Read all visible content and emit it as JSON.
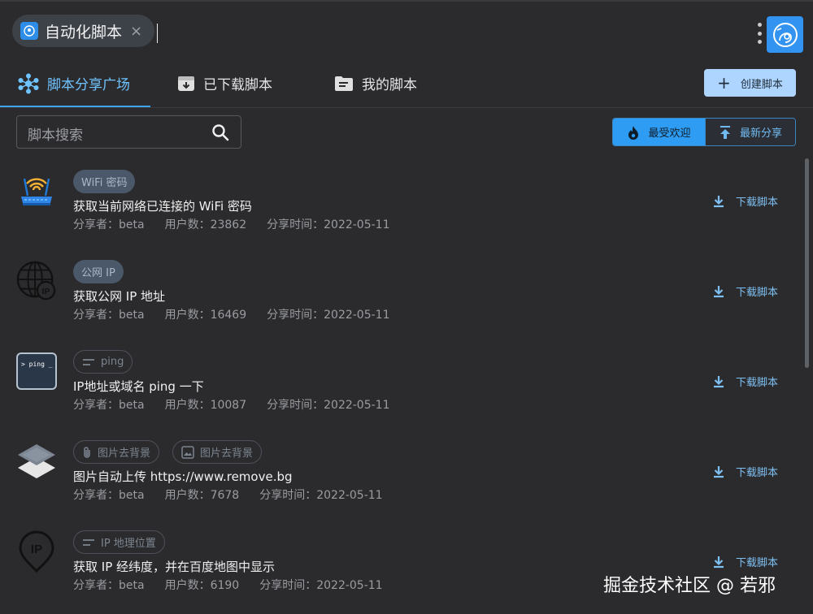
{
  "header": {
    "app_title": "自动化脚本",
    "close_symbol": "×"
  },
  "tabs": [
    {
      "label": "脚本分享广场",
      "icon": "hub-icon"
    },
    {
      "label": "已下载脚本",
      "icon": "archive-icon"
    },
    {
      "label": "我的脚本",
      "icon": "folder-icon"
    }
  ],
  "create_button": {
    "label": "创建脚本",
    "icon": "plus-icon"
  },
  "search": {
    "placeholder": "脚本搜索"
  },
  "sort": {
    "hot_label": "最受欢迎",
    "new_label": "最新分享"
  },
  "download_label": "下载脚本",
  "items": [
    {
      "icon": "router-icon",
      "tags": [
        {
          "label": "WiFi 密码",
          "style": "filled"
        }
      ],
      "name": "获取当前网络已连接的 WiFi 密码",
      "sharer": "分享者：beta",
      "users": "用户数：23862",
      "time": "分享时间：2022-05-11"
    },
    {
      "icon": "globe-ip-icon",
      "tags": [
        {
          "label": "公网 IP",
          "style": "filled"
        }
      ],
      "name": "获取公网 IP 地址",
      "sharer": "分享者：beta",
      "users": "用户数：16469",
      "time": "分享时间：2022-05-11"
    },
    {
      "icon": "terminal-icon",
      "icon_text": "> ping _",
      "tags": [
        {
          "label": "ping",
          "style": "outlined",
          "icon": "text-lines-icon"
        }
      ],
      "name": "IP地址或域名 ping 一下",
      "sharer": "分享者：beta",
      "users": "用户数：10087",
      "time": "分享时间：2022-05-11"
    },
    {
      "icon": "layers-icon",
      "tags": [
        {
          "label": "图片去背景",
          "style": "outlined",
          "icon": "attachment-icon"
        },
        {
          "label": "图片去背景",
          "style": "outlined",
          "icon": "image-icon"
        }
      ],
      "name": "图片自动上传 https://www.remove.bg",
      "sharer": "分享者：beta",
      "users": "用户数：7678",
      "time": "分享时间：2022-05-11"
    },
    {
      "icon": "location-ip-icon",
      "tags": [
        {
          "label": "IP 地理位置",
          "style": "outlined",
          "icon": "text-lines-icon"
        }
      ],
      "name": "获取 IP 经纬度，并在百度地图中显示",
      "sharer": "分享者：beta",
      "users": "用户数：6190",
      "time": "分享时间：2022-05-11"
    }
  ],
  "watermark": "掘金技术社区 @ 若邪",
  "colors": {
    "background": "#2b2b2e",
    "accent": "#2e9cf2",
    "accent_light": "#aed5ff",
    "link": "#7ec0f2"
  }
}
